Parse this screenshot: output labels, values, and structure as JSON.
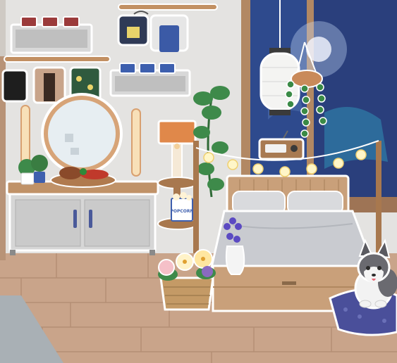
{
  "scene": {
    "type": "room-decoration",
    "colors": {
      "wall": "#e4e3e1",
      "floor": "#c9a48a",
      "wood": "#a8784e",
      "window_sky": "#2f4a8c",
      "bed_blanket": "#c9cbd0",
      "dog_cushion": "#4a4f9a"
    }
  },
  "labels": {
    "popcorn_box": "POPCORN"
  },
  "icons": [
    "shelf-with-soda-cans",
    "clothes-rack",
    "hanging-lantern",
    "hanging-plant",
    "vanity-mirror",
    "dresser",
    "table-lamp",
    "radio",
    "bed",
    "string-lights",
    "flower-basket",
    "vase-lavender",
    "husky-dog"
  ]
}
